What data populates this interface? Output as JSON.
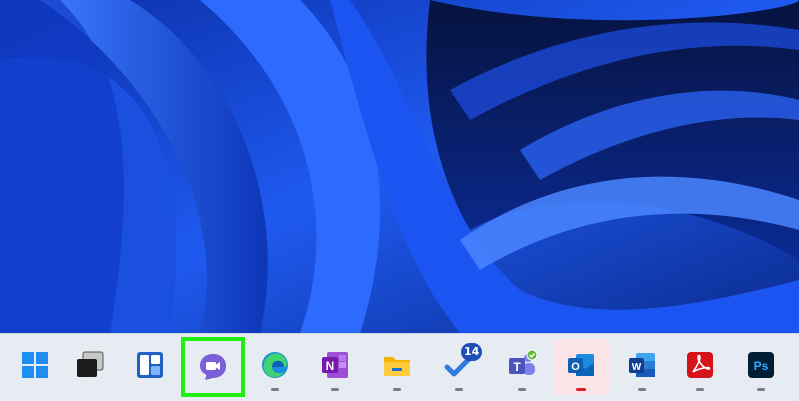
{
  "desktop": {
    "wallpaper": "blue-swirl"
  },
  "taskbar": {
    "items": [
      {
        "name": "start",
        "icon": "windows-logo-icon",
        "running": false,
        "active": false
      },
      {
        "name": "task-view",
        "icon": "task-view-icon",
        "running": false,
        "active": false
      },
      {
        "name": "widgets",
        "icon": "widgets-icon",
        "running": false,
        "active": false
      },
      {
        "name": "chat",
        "icon": "teams-chat-icon",
        "running": false,
        "active": false,
        "highlighted": true
      },
      {
        "name": "edge",
        "icon": "edge-icon",
        "running": true,
        "active": false
      },
      {
        "name": "onenote",
        "icon": "onenote-icon",
        "running": true,
        "active": false,
        "glyph": "N"
      },
      {
        "name": "file-explorer",
        "icon": "folder-icon",
        "running": true,
        "active": false
      },
      {
        "name": "todo",
        "icon": "todo-icon",
        "running": true,
        "active": false,
        "badge": "14"
      },
      {
        "name": "teams",
        "icon": "teams-icon",
        "running": true,
        "active": false,
        "glyph": "T"
      },
      {
        "name": "outlook",
        "icon": "outlook-icon",
        "running": true,
        "active": true,
        "glyph": "O"
      },
      {
        "name": "word",
        "icon": "word-icon",
        "running": true,
        "active": false,
        "glyph": "W"
      },
      {
        "name": "acrobat",
        "icon": "acrobat-icon",
        "running": true,
        "active": false
      },
      {
        "name": "photoshop",
        "icon": "photoshop-icon",
        "running": true,
        "active": false,
        "glyph": "Ps"
      }
    ]
  },
  "colors": {
    "highlight": "#22ee11",
    "active_bg": "#fbe4e8",
    "active_indicator": "#d81f2a",
    "badge": "#1f4fb6"
  }
}
